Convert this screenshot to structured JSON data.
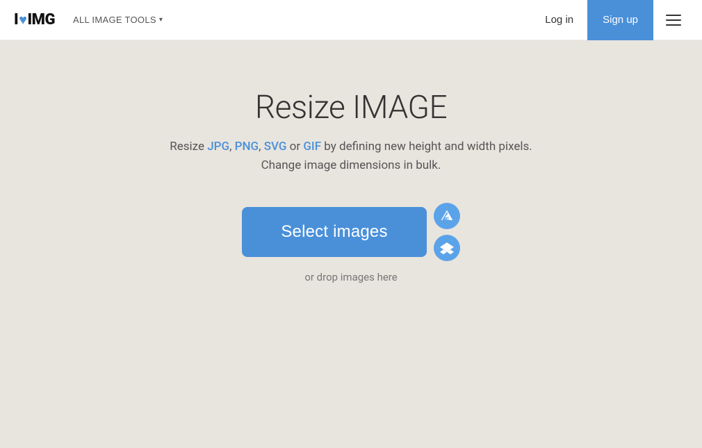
{
  "header": {
    "logo_text_i": "I",
    "logo_text_img": "IMG",
    "all_tools_label": "ALL IMAGE TOOLS",
    "login_label": "Log in",
    "signup_label": "Sign up"
  },
  "main": {
    "title": "Resize IMAGE",
    "subtitle_prefix": "Resize ",
    "format_jpg": "JPG",
    "format_png": "PNG",
    "format_svg": "SVG",
    "subtitle_or": " or ",
    "format_gif": "GIF",
    "subtitle_suffix": " by defining new height and width pixels.",
    "subtitle_line2": "Change image dimensions in bulk.",
    "select_button_label": "Select images",
    "drop_text": "or drop images here"
  }
}
